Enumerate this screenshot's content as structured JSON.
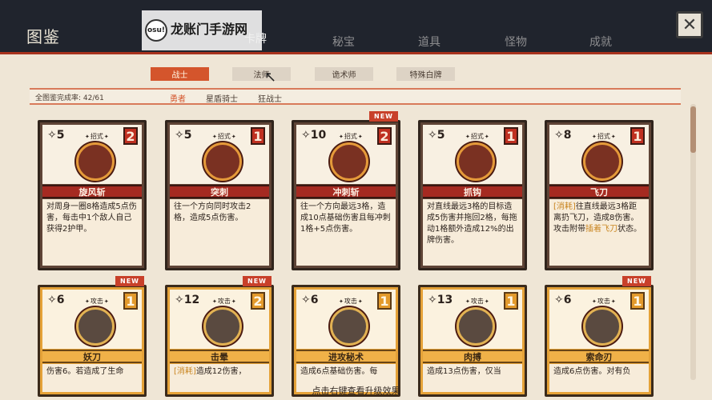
{
  "header": {
    "title": "图鉴",
    "tabs": [
      {
        "label": "卡牌",
        "active": true
      },
      {
        "label": "秘宝",
        "active": false
      },
      {
        "label": "道具",
        "active": false
      },
      {
        "label": "怪物",
        "active": false
      },
      {
        "label": "成就",
        "active": false
      }
    ],
    "close_label": "✕"
  },
  "watermark": {
    "badge": "osu!",
    "text": "龙账门手游网"
  },
  "class_tabs": [
    {
      "label": "战士",
      "active": true
    },
    {
      "label": "法师",
      "active": false
    },
    {
      "label": "诡术师",
      "active": false
    },
    {
      "label": "特殊白牌",
      "active": false
    }
  ],
  "progress": {
    "text": "全图鉴完成率: 42/61",
    "sub_tabs": [
      {
        "label": "勇者",
        "active": true
      },
      {
        "label": "星盾骑士",
        "active": false
      },
      {
        "label": "狂战士",
        "active": false
      }
    ]
  },
  "cards": [
    {
      "cost": "5",
      "type": "招式",
      "level": "2",
      "name": "旋风斩",
      "is_new": false,
      "new_label": "",
      "desc_prefix": "",
      "desc": "对周身一圈8格造成5点伤害，每击中1个敌人自己获得2护甲。",
      "art": "whirlwind-icon"
    },
    {
      "cost": "5",
      "type": "招式",
      "level": "1",
      "name": "突刺",
      "is_new": false,
      "new_label": "",
      "desc_prefix": "",
      "desc": "往一个方向同时攻击2格，造成5点伤害。",
      "art": "thrust-icon"
    },
    {
      "cost": "10",
      "type": "招式",
      "level": "2",
      "name": "冲刺斩",
      "is_new": true,
      "new_label": "NEW",
      "desc_prefix": "",
      "desc": "往一个方向最远3格，造成10点基础伤害且每冲刺1格+5点伤害。",
      "art": "dash-slash-icon"
    },
    {
      "cost": "5",
      "type": "招式",
      "level": "1",
      "name": "抓钩",
      "is_new": false,
      "new_label": "",
      "desc_prefix": "",
      "desc": "对直线最远3格的目标造成5伤害并拖回2格，每拖动1格额外造成12%的出牌伤害。",
      "art": "grapple-hook-icon"
    },
    {
      "cost": "8",
      "type": "招式",
      "level": "1",
      "name": "飞刀",
      "is_new": false,
      "new_label": "",
      "desc_prefix": "[消耗]",
      "desc": "往直线最远3格距离扔飞刀，造成8伤害。攻击附带",
      "desc_hl": "插着飞刀",
      "desc_suffix": "状态。",
      "art": "throwing-knife-icon"
    },
    {
      "cost": "6",
      "type": "攻击",
      "level": "1",
      "name": "妖刀",
      "is_new": true,
      "new_label": "NEW",
      "desc_prefix": "",
      "desc": "伤害6。若造成了生命",
      "art": "demon-blade-icon"
    },
    {
      "cost": "12",
      "type": "攻击",
      "level": "2",
      "name": "击晕",
      "is_new": true,
      "new_label": "NEW",
      "desc_prefix": "[消耗]",
      "desc": "造成12伤害，",
      "art": "stun-icon"
    },
    {
      "cost": "6",
      "type": "攻击",
      "level": "1",
      "name": "进攻秘术",
      "is_new": false,
      "new_label": "",
      "desc_prefix": "",
      "desc": "造成6点基础伤害。每",
      "art": "offense-arcana-icon"
    },
    {
      "cost": "13",
      "type": "攻击",
      "level": "1",
      "name": "肉搏",
      "is_new": false,
      "new_label": "",
      "desc_prefix": "",
      "desc": "造成13点伤害，仅当",
      "art": "brawl-icon"
    },
    {
      "cost": "6",
      "type": "攻击",
      "level": "1",
      "name": "索命刃",
      "is_new": true,
      "new_label": "NEW",
      "desc_prefix": "",
      "desc": "造成6点伤害。对有负",
      "art": "reaper-blade-icon"
    }
  ],
  "footer": {
    "hint": "点击右键查看升级效果"
  },
  "colors": {
    "accent": "#d4552c",
    "header_bg": "#20242d",
    "card_red": "#a52a21",
    "card_gold": "#f0b148"
  }
}
